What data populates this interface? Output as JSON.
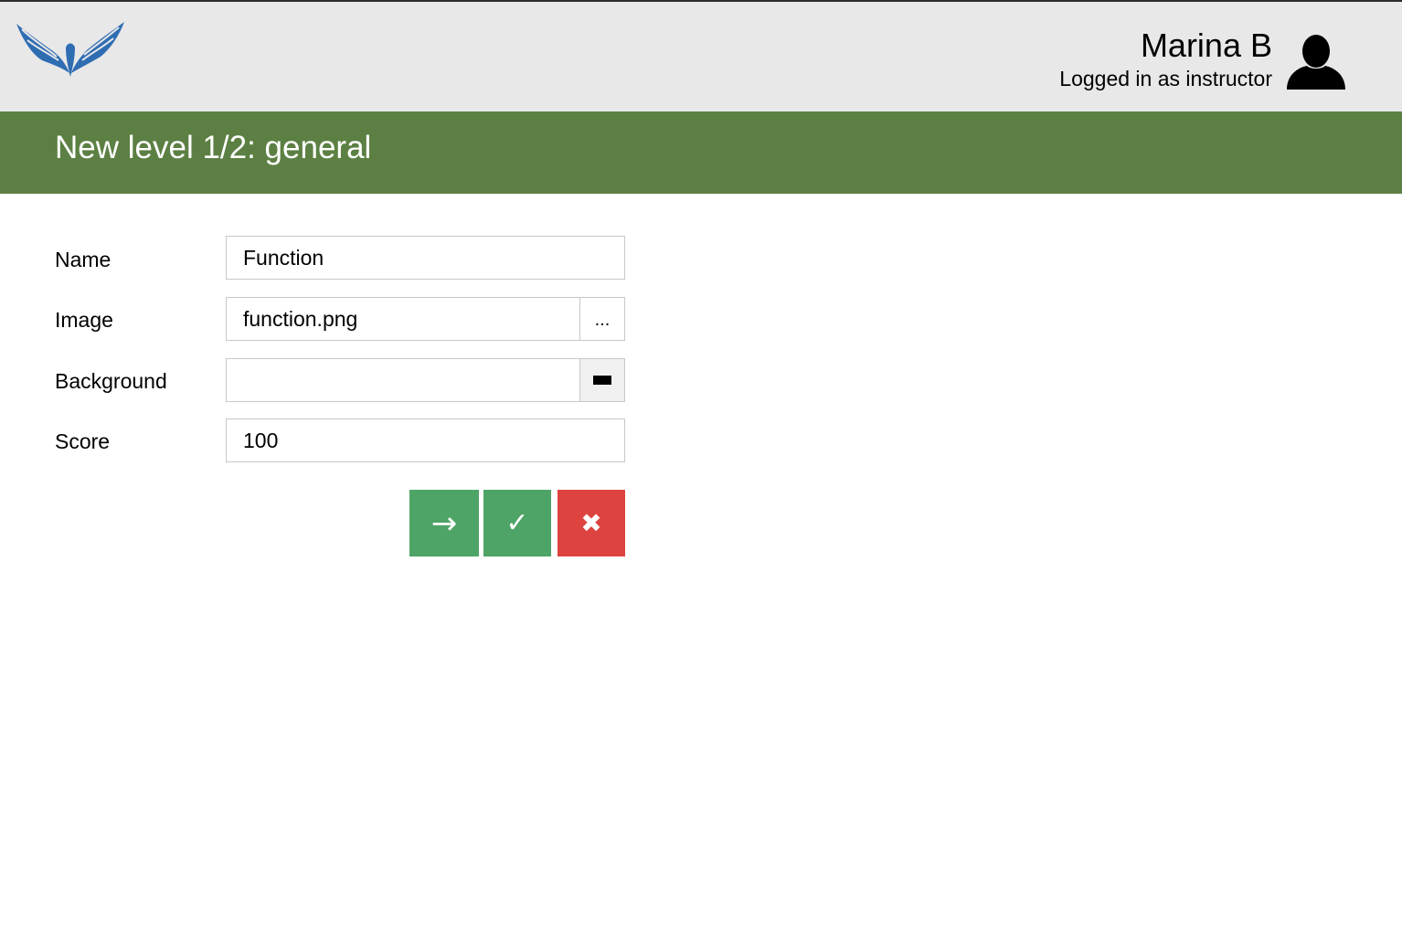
{
  "header": {
    "logo_icon": "winged-bird-logo",
    "user_name": "Marina B",
    "user_role": "Logged in as instructor",
    "user_icon": "user-silhouette-icon"
  },
  "banner": {
    "title": "New level 1/2: general"
  },
  "form": {
    "name": {
      "label": "Name",
      "value": "Function"
    },
    "image": {
      "label": "Image",
      "value": "function.png",
      "browse_label": "..."
    },
    "background": {
      "label": "Background",
      "value": "",
      "picker_icon": "color-swatch-icon",
      "swatch_color": "#000000"
    },
    "score": {
      "label": "Score",
      "value": "100"
    }
  },
  "actions": {
    "next": {
      "label": "→",
      "color": "#4da466"
    },
    "save": {
      "label": "✓",
      "color": "#4da466"
    },
    "cancel": {
      "label": "✖",
      "color": "#dd4440"
    }
  },
  "colors": {
    "header_bg": "#e8e8e8",
    "banner_bg": "#5c8043",
    "logo_blue": "#2f6db3"
  }
}
